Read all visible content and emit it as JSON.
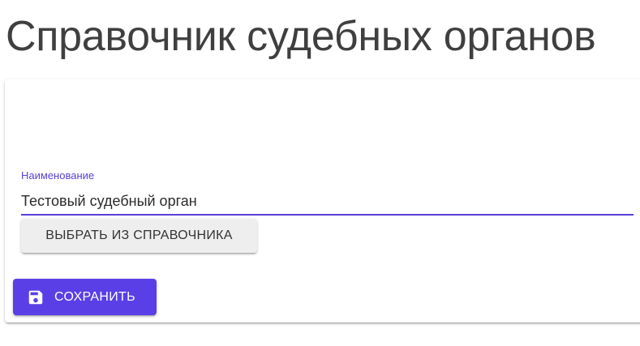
{
  "page": {
    "title": "Справочник судебных органов"
  },
  "form": {
    "name_field": {
      "label": "Наименование",
      "value": "Тестовый судебный орган"
    },
    "select_button_label": "ВЫБРАТЬ ИЗ СПРАВОЧНИКА",
    "save_button_label": "СОХРАНИТЬ",
    "save_icon": "floppy-disk-icon"
  },
  "colors": {
    "accent": "#5b3fe6",
    "title_text": "#3f3f3f",
    "secondary_button_bg": "#eeeeee"
  }
}
